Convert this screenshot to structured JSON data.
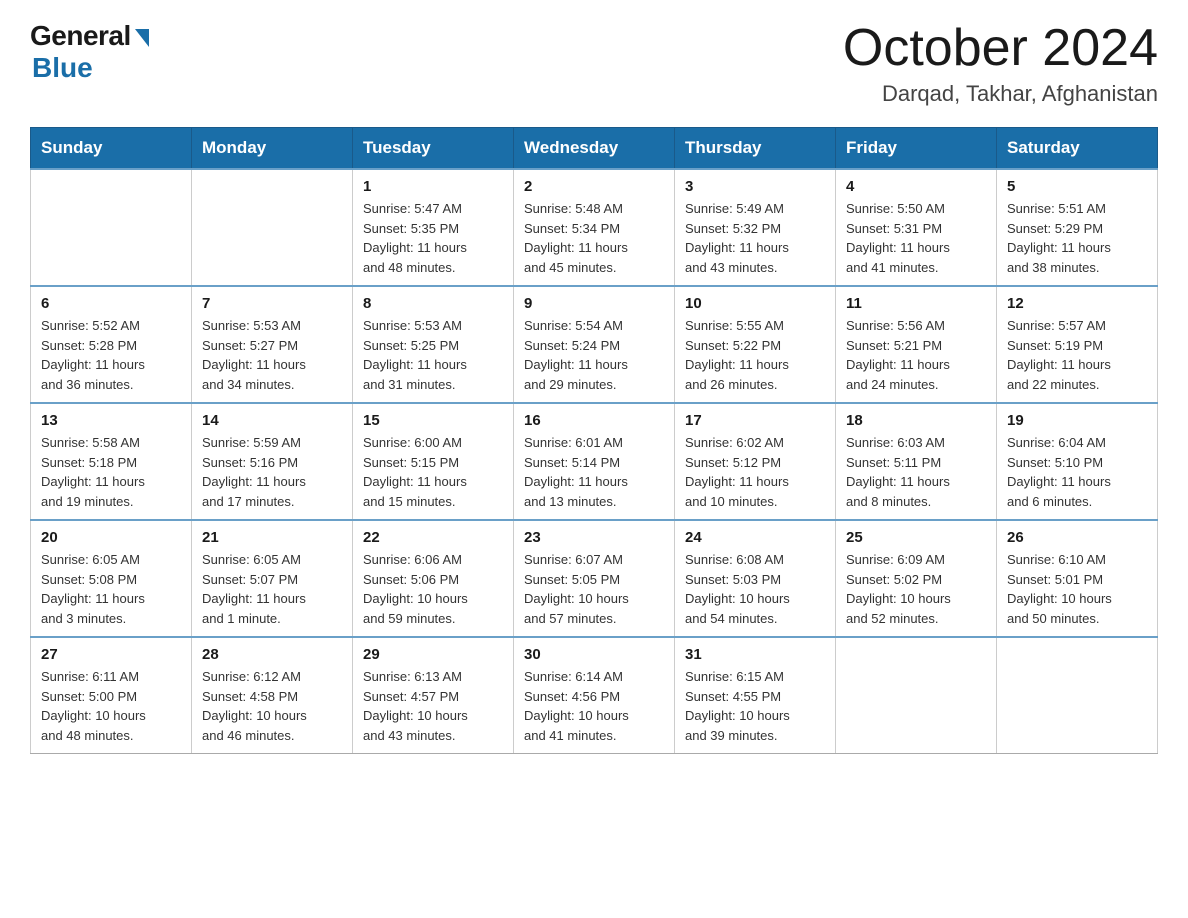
{
  "logo": {
    "general": "General",
    "blue": "Blue"
  },
  "title": "October 2024",
  "location": "Darqad, Takhar, Afghanistan",
  "days_of_week": [
    "Sunday",
    "Monday",
    "Tuesday",
    "Wednesday",
    "Thursday",
    "Friday",
    "Saturday"
  ],
  "weeks": [
    [
      {
        "day": "",
        "info": ""
      },
      {
        "day": "",
        "info": ""
      },
      {
        "day": "1",
        "info": "Sunrise: 5:47 AM\nSunset: 5:35 PM\nDaylight: 11 hours\nand 48 minutes."
      },
      {
        "day": "2",
        "info": "Sunrise: 5:48 AM\nSunset: 5:34 PM\nDaylight: 11 hours\nand 45 minutes."
      },
      {
        "day": "3",
        "info": "Sunrise: 5:49 AM\nSunset: 5:32 PM\nDaylight: 11 hours\nand 43 minutes."
      },
      {
        "day": "4",
        "info": "Sunrise: 5:50 AM\nSunset: 5:31 PM\nDaylight: 11 hours\nand 41 minutes."
      },
      {
        "day": "5",
        "info": "Sunrise: 5:51 AM\nSunset: 5:29 PM\nDaylight: 11 hours\nand 38 minutes."
      }
    ],
    [
      {
        "day": "6",
        "info": "Sunrise: 5:52 AM\nSunset: 5:28 PM\nDaylight: 11 hours\nand 36 minutes."
      },
      {
        "day": "7",
        "info": "Sunrise: 5:53 AM\nSunset: 5:27 PM\nDaylight: 11 hours\nand 34 minutes."
      },
      {
        "day": "8",
        "info": "Sunrise: 5:53 AM\nSunset: 5:25 PM\nDaylight: 11 hours\nand 31 minutes."
      },
      {
        "day": "9",
        "info": "Sunrise: 5:54 AM\nSunset: 5:24 PM\nDaylight: 11 hours\nand 29 minutes."
      },
      {
        "day": "10",
        "info": "Sunrise: 5:55 AM\nSunset: 5:22 PM\nDaylight: 11 hours\nand 26 minutes."
      },
      {
        "day": "11",
        "info": "Sunrise: 5:56 AM\nSunset: 5:21 PM\nDaylight: 11 hours\nand 24 minutes."
      },
      {
        "day": "12",
        "info": "Sunrise: 5:57 AM\nSunset: 5:19 PM\nDaylight: 11 hours\nand 22 minutes."
      }
    ],
    [
      {
        "day": "13",
        "info": "Sunrise: 5:58 AM\nSunset: 5:18 PM\nDaylight: 11 hours\nand 19 minutes."
      },
      {
        "day": "14",
        "info": "Sunrise: 5:59 AM\nSunset: 5:16 PM\nDaylight: 11 hours\nand 17 minutes."
      },
      {
        "day": "15",
        "info": "Sunrise: 6:00 AM\nSunset: 5:15 PM\nDaylight: 11 hours\nand 15 minutes."
      },
      {
        "day": "16",
        "info": "Sunrise: 6:01 AM\nSunset: 5:14 PM\nDaylight: 11 hours\nand 13 minutes."
      },
      {
        "day": "17",
        "info": "Sunrise: 6:02 AM\nSunset: 5:12 PM\nDaylight: 11 hours\nand 10 minutes."
      },
      {
        "day": "18",
        "info": "Sunrise: 6:03 AM\nSunset: 5:11 PM\nDaylight: 11 hours\nand 8 minutes."
      },
      {
        "day": "19",
        "info": "Sunrise: 6:04 AM\nSunset: 5:10 PM\nDaylight: 11 hours\nand 6 minutes."
      }
    ],
    [
      {
        "day": "20",
        "info": "Sunrise: 6:05 AM\nSunset: 5:08 PM\nDaylight: 11 hours\nand 3 minutes."
      },
      {
        "day": "21",
        "info": "Sunrise: 6:05 AM\nSunset: 5:07 PM\nDaylight: 11 hours\nand 1 minute."
      },
      {
        "day": "22",
        "info": "Sunrise: 6:06 AM\nSunset: 5:06 PM\nDaylight: 10 hours\nand 59 minutes."
      },
      {
        "day": "23",
        "info": "Sunrise: 6:07 AM\nSunset: 5:05 PM\nDaylight: 10 hours\nand 57 minutes."
      },
      {
        "day": "24",
        "info": "Sunrise: 6:08 AM\nSunset: 5:03 PM\nDaylight: 10 hours\nand 54 minutes."
      },
      {
        "day": "25",
        "info": "Sunrise: 6:09 AM\nSunset: 5:02 PM\nDaylight: 10 hours\nand 52 minutes."
      },
      {
        "day": "26",
        "info": "Sunrise: 6:10 AM\nSunset: 5:01 PM\nDaylight: 10 hours\nand 50 minutes."
      }
    ],
    [
      {
        "day": "27",
        "info": "Sunrise: 6:11 AM\nSunset: 5:00 PM\nDaylight: 10 hours\nand 48 minutes."
      },
      {
        "day": "28",
        "info": "Sunrise: 6:12 AM\nSunset: 4:58 PM\nDaylight: 10 hours\nand 46 minutes."
      },
      {
        "day": "29",
        "info": "Sunrise: 6:13 AM\nSunset: 4:57 PM\nDaylight: 10 hours\nand 43 minutes."
      },
      {
        "day": "30",
        "info": "Sunrise: 6:14 AM\nSunset: 4:56 PM\nDaylight: 10 hours\nand 41 minutes."
      },
      {
        "day": "31",
        "info": "Sunrise: 6:15 AM\nSunset: 4:55 PM\nDaylight: 10 hours\nand 39 minutes."
      },
      {
        "day": "",
        "info": ""
      },
      {
        "day": "",
        "info": ""
      }
    ]
  ]
}
